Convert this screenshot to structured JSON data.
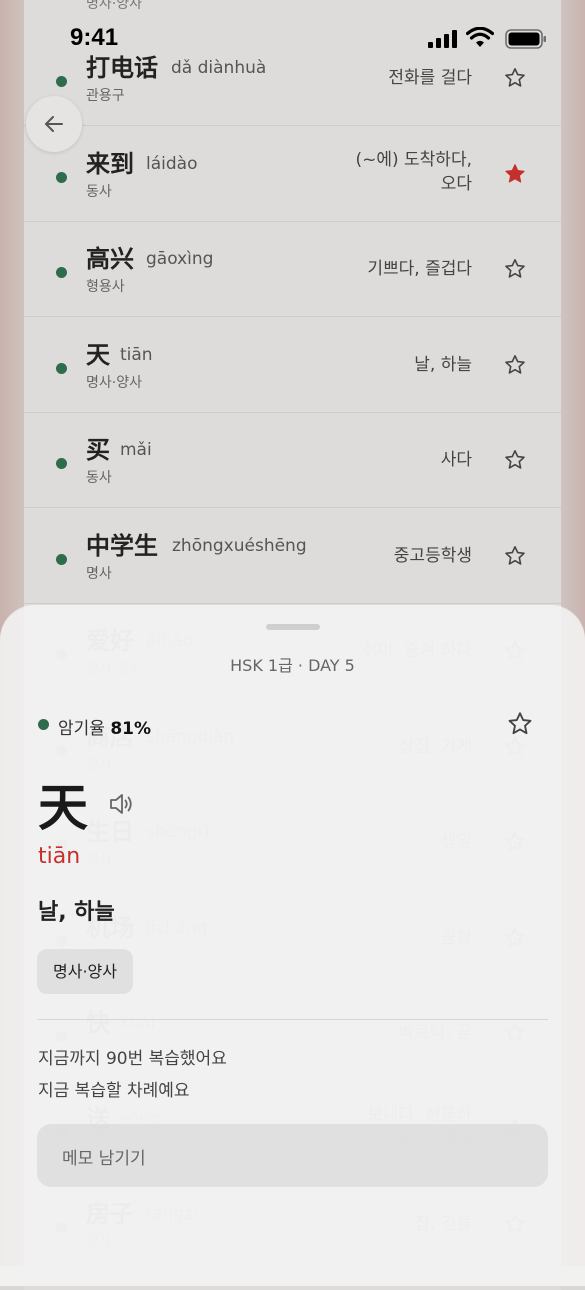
{
  "status_bar": {
    "time": "9:41"
  },
  "top_partial_pos": "명사·양사",
  "words": [
    {
      "hanzi": "打电话",
      "pinyin": "dǎ diànhuà",
      "pos": "관용구",
      "meaning": "전화를 걸다",
      "starred": false
    },
    {
      "hanzi": "来到",
      "pinyin": "láidào",
      "pos": "동사",
      "meaning": "(~에) 도착하다, 오다",
      "starred": true
    },
    {
      "hanzi": "高兴",
      "pinyin": "gāoxìng",
      "pos": "형용사",
      "meaning": "기쁘다, 즐겁다",
      "starred": false
    },
    {
      "hanzi": "天",
      "pinyin": "tiān",
      "pos": "명사·양사",
      "meaning": "날, 하늘",
      "starred": false
    },
    {
      "hanzi": "买",
      "pinyin": "mǎi",
      "pos": "동사",
      "meaning": "사다",
      "starred": false
    },
    {
      "hanzi": "中学生",
      "pinyin": "zhōngxuéshēng",
      "pos": "명사",
      "meaning": "중고등학생",
      "starred": false
    },
    {
      "hanzi": "爱好",
      "pinyin": "àihào",
      "pos": "동사·명사",
      "meaning": "취미, 즐겨 하다",
      "starred": false
    },
    {
      "hanzi": "商店",
      "pinyin": "shāngdiàn",
      "pos": "명사",
      "meaning": "상점, 가게",
      "starred": false
    },
    {
      "hanzi": "生日",
      "pinyin": "shēngrì",
      "pos": "명사",
      "meaning": "생일",
      "starred": false
    },
    {
      "hanzi": "机场",
      "pinyin": "jīchǎng",
      "pos": "명사",
      "meaning": "공항",
      "starred": false
    },
    {
      "hanzi": "快",
      "pinyin": "kuài",
      "pos": "",
      "meaning": "빠르다, 곧",
      "starred": false
    },
    {
      "hanzi": "送",
      "pinyin": "sòng",
      "pos": "",
      "meaning": "보내다, 선물하다, 바래다주다",
      "starred": false
    },
    {
      "hanzi": "房子",
      "pinyin": "fángzi",
      "pos": "명사",
      "meaning": "집, 건물",
      "starred": false
    }
  ],
  "sheet": {
    "title": "HSK 1급 · DAY 5",
    "memory_label": "암기율",
    "memory_rate": "81%",
    "hanzi": "天",
    "pinyin_initial": "ti",
    "pinyin_toned": "ā",
    "pinyin_final": "n",
    "meaning": "날, 하늘",
    "pos": "명사·양사",
    "review_count_text": "지금까지 90번 복습했어요",
    "review_status_text": "지금 복습할 차례예요",
    "memo_placeholder": "메모 남기기"
  },
  "colors": {
    "accent_red": "#c4302b",
    "dot_green": "#2f6b4d"
  }
}
